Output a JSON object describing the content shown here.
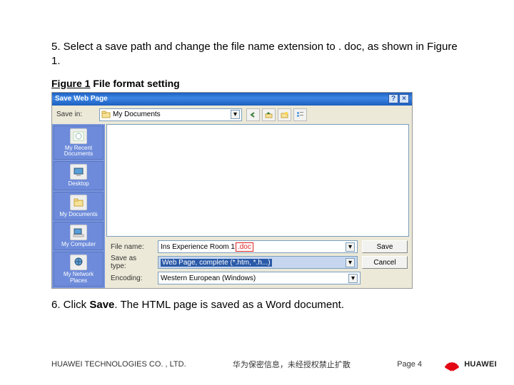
{
  "steps": {
    "s5": "5. Select a save path and change the file name extension to . doc, as shown in Figure 1.",
    "s6_pre": "6. Click ",
    "s6_save": "Save",
    "s6_post": ". The HTML page is saved as a Word document."
  },
  "figcap": {
    "label": "Figure 1",
    "rest": " File format setting"
  },
  "dialog": {
    "title": "Save Web Page",
    "savein_label": "Save in:",
    "savein_value": "My Documents",
    "places": [
      "My Recent Documents",
      "Desktop",
      "My Documents",
      "My Computer",
      "My Network Places"
    ],
    "filename_label": "File name:",
    "filename_value": "Ins Experience Room 1",
    "filename_ext": ".doc",
    "saveastype_label": "Save as type:",
    "saveastype_value": "Web Page, complete (*.htm, *.h...)",
    "encoding_label": "Encoding:",
    "encoding_value": "Western European (Windows)",
    "btn_save": "Save",
    "btn_cancel": "Cancel",
    "icons": {
      "help": "?",
      "close": "×",
      "folder": "folder-icon",
      "back": "back-icon",
      "up": "up-icon",
      "new": "new-folder-icon",
      "views": "views-icon",
      "arrow": "▾"
    }
  },
  "footer": {
    "company": "HUAWEI TECHNOLOGIES CO. , LTD.",
    "confidential": "华为保密信息，未经授权禁止扩散",
    "page": "Page 4",
    "brand": "HUAWEI"
  }
}
